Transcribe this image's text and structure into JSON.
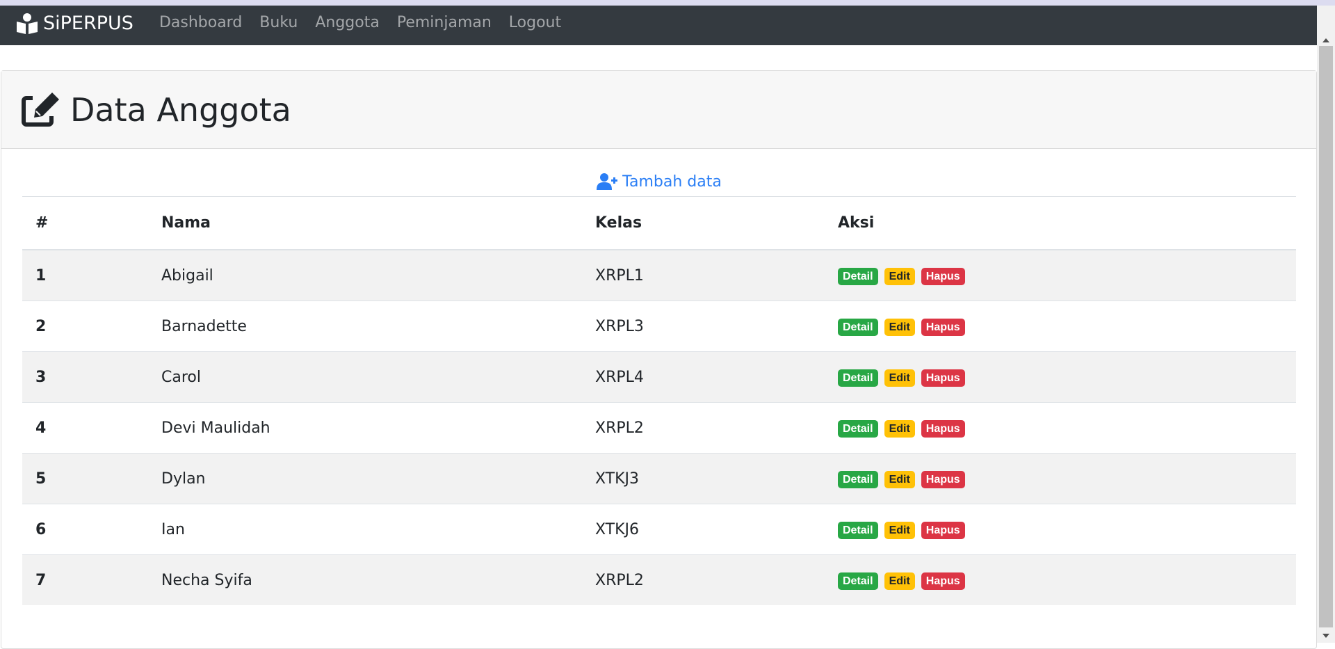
{
  "navbar": {
    "brand": "SiPERPUS",
    "links": [
      "Dashboard",
      "Buku",
      "Anggota",
      "Peminjaman",
      "Logout"
    ]
  },
  "page": {
    "title": "Data Anggota",
    "add_label": "Tambah data"
  },
  "table": {
    "headers": [
      "#",
      "Nama",
      "Kelas",
      "Aksi"
    ],
    "rows": [
      {
        "no": "1",
        "nama": "Abigail",
        "kelas": "XRPL1"
      },
      {
        "no": "2",
        "nama": "Barnadette",
        "kelas": "XRPL3"
      },
      {
        "no": "3",
        "nama": "Carol",
        "kelas": "XRPL4"
      },
      {
        "no": "4",
        "nama": "Devi Maulidah",
        "kelas": "XRPL2"
      },
      {
        "no": "5",
        "nama": "Dylan",
        "kelas": "XTKJ3"
      },
      {
        "no": "6",
        "nama": "Ian",
        "kelas": "XTKJ6"
      },
      {
        "no": "7",
        "nama": "Necha Syifa",
        "kelas": "XRPL2"
      }
    ],
    "actions": {
      "detail": "Detail",
      "edit": "Edit",
      "hapus": "Hapus"
    }
  },
  "colors": {
    "navbar_bg": "#343a40",
    "link": "#2a7ef5",
    "detail": "#28a745",
    "edit": "#ffc107",
    "hapus": "#dc3545"
  },
  "icons": [
    "book-reader-icon",
    "edit-icon",
    "user-plus-icon"
  ]
}
